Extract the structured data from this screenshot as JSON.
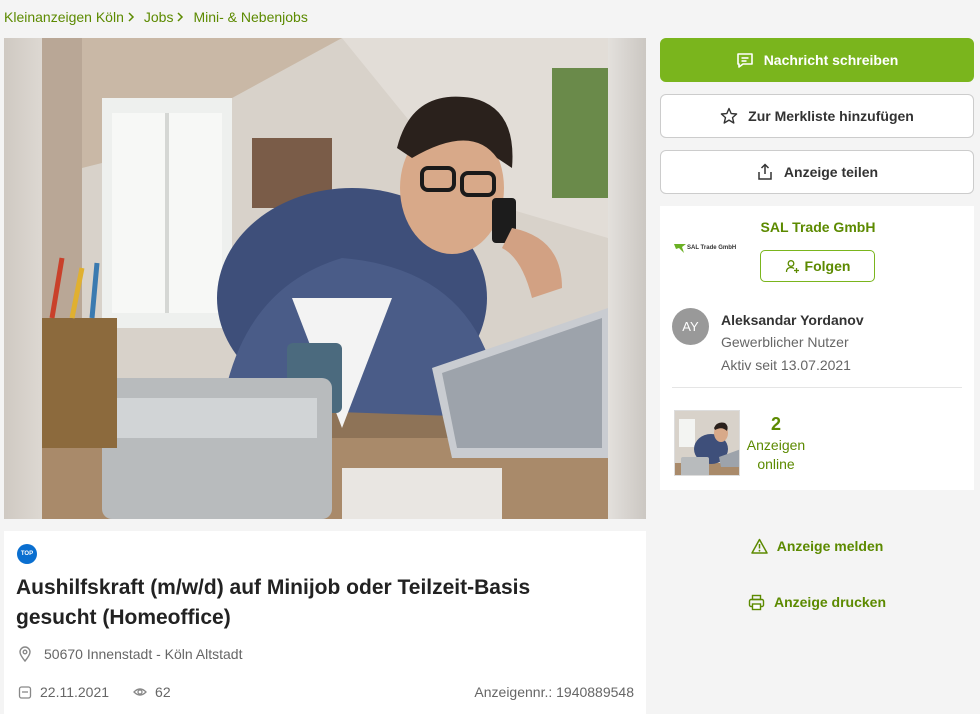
{
  "breadcrumb": [
    "Kleinanzeigen Köln",
    "Jobs",
    "Mini- & Nebenjobs"
  ],
  "ad": {
    "badge": "TOP",
    "title": "Aushilfskraft (m/w/d) auf Minijob oder Teilzeit-Basis gesucht (Homeoffice)",
    "location": "50670 Innenstadt - Köln Altstadt",
    "date": "22.11.2021",
    "views": "62",
    "ad_number": "Anzeigennr.: 1940889548"
  },
  "buttons": {
    "message": "Nachricht schreiben",
    "watchlist": "Zur Merkliste hinzufügen",
    "share": "Anzeige teilen"
  },
  "seller": {
    "company": "SAL Trade GmbH",
    "logo_text": "SAL Trade GmbH",
    "follow": "Folgen",
    "avatar_initials": "AY",
    "name": "Aleksandar Yordanov",
    "type": "Gewerblicher Nutzer",
    "active_since": "Aktiv seit 13.07.2021",
    "ads_count": "2",
    "ads_label_1": "Anzeigen",
    "ads_label_2": "online"
  },
  "actions": {
    "report": "Anzeige melden",
    "print": "Anzeige drucken"
  },
  "colors": {
    "accent": "#7ab51d",
    "link": "#5c8a00",
    "badge": "#0a6fd0"
  },
  "icons": [
    "chevron-right-icon",
    "message-icon",
    "star-icon",
    "share-icon",
    "follow-user-icon",
    "warning-icon",
    "printer-icon",
    "location-pin-icon",
    "calendar-icon",
    "eye-icon"
  ]
}
